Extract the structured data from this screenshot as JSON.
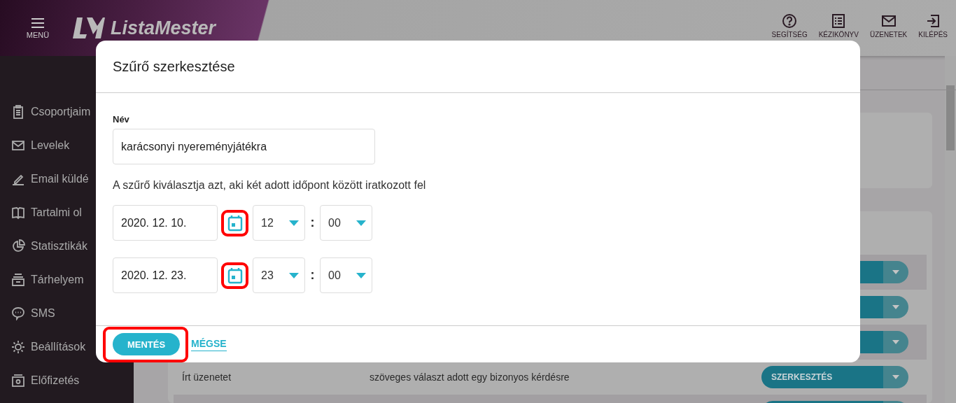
{
  "header": {
    "menu_label": "MENÜ",
    "logo_text": "ListaMester",
    "actions": [
      {
        "label": "SEGÍTSÉG"
      },
      {
        "label": "KÉZIKÖNYV"
      },
      {
        "label": "ÜZENETEK"
      },
      {
        "label": "KILÉPÉS"
      }
    ]
  },
  "sidebar": {
    "items": [
      {
        "label": "Csoportjaim"
      },
      {
        "label": "Levelek"
      },
      {
        "label": "Email küldé"
      },
      {
        "label": "Tartalmi ol"
      },
      {
        "label": "Statisztikák"
      },
      {
        "label": "Tárhelyem"
      },
      {
        "label": "SMS"
      },
      {
        "label": "Beállítások"
      },
      {
        "label": "Előfizetés"
      }
    ]
  },
  "table": {
    "rows": [
      {
        "shaded": true
      },
      {
        "shaded": false
      },
      {
        "shaded": true
      },
      {
        "shaded": false,
        "column_1": "Írt üzenetet",
        "column_2": "szöveges választ adott egy bizonyos kérdésre",
        "action": "SZERKESZTÉS"
      },
      {
        "shaded": true
      }
    ]
  },
  "dialog": {
    "title": "Szűrő szerkesztése",
    "name_label": "Név",
    "name_value": "karácsonyi nyereményjátékra",
    "description": "A szűrő kiválasztja azt, aki két adott időpont között iratkozott fel",
    "ranges": [
      {
        "date": "2020. 12. 10.",
        "hour": "12",
        "separator": ":",
        "minute": "00",
        "highlighted": true
      },
      {
        "date": "2020. 12. 23.",
        "hour": "23",
        "separator": ":",
        "minute": "00",
        "highlighted": true
      }
    ],
    "buttons": [
      {
        "label": "MENTÉS",
        "kind": "primary",
        "highlighted": true
      },
      {
        "label": "MÉGSE",
        "kind": "link",
        "highlighted": false
      }
    ]
  }
}
